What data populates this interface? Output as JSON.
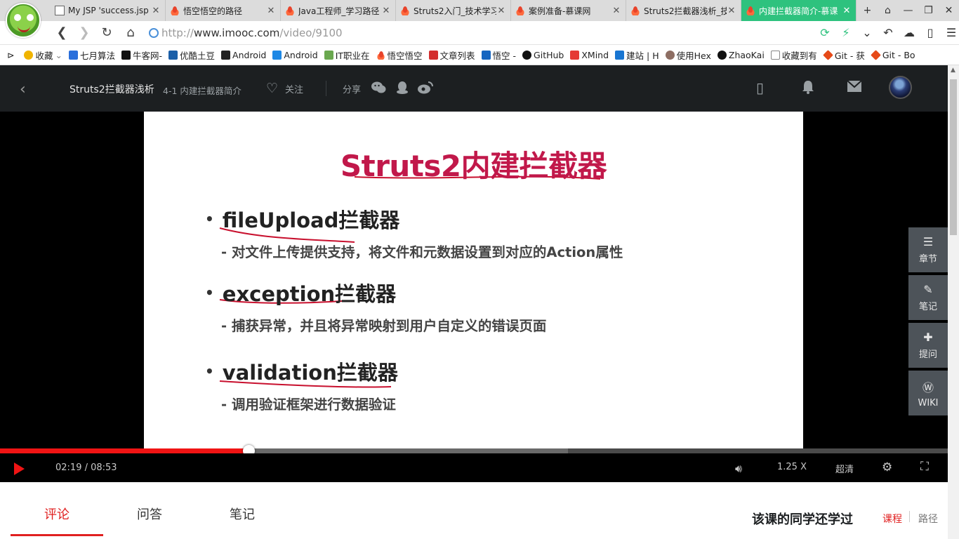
{
  "browser": {
    "tabs": [
      {
        "title": "My JSP 'success.jsp",
        "icon": "page-icon",
        "active": false
      },
      {
        "title": "悟空悟空的路径",
        "icon": "fire-icon",
        "active": false
      },
      {
        "title": "Java工程师_学习路径",
        "icon": "fire-icon",
        "active": false
      },
      {
        "title": "Struts2入门_技术学习",
        "icon": "fire-icon",
        "active": false
      },
      {
        "title": "案例准备-慕课网",
        "icon": "fire-icon",
        "active": false
      },
      {
        "title": "Struts2拦截器浅析_技",
        "icon": "fire-icon",
        "active": false
      },
      {
        "title": "内建拦截器简介-慕课",
        "icon": "fire-icon",
        "active": true
      }
    ],
    "url": {
      "scheme": "http://",
      "host": "www.imooc.com",
      "path": "/video/9100"
    },
    "bookmarks": [
      {
        "label": "收藏",
        "color": "#f0b400"
      },
      {
        "label": "七月算法",
        "color": "#2a6fdb"
      },
      {
        "label": "牛客网-",
        "color": "#111111"
      },
      {
        "label": "优酷土豆",
        "color": "#1b5fa8"
      },
      {
        "label": "Android",
        "color": "#222222"
      },
      {
        "label": "Android",
        "color": "#1e88e5"
      },
      {
        "label": "IT职业在",
        "color": "#6aa84f"
      },
      {
        "label": "悟空悟空",
        "color": "#e8432b"
      },
      {
        "label": "文章列表",
        "color": "#d32f2f"
      },
      {
        "label": "悟空 -",
        "color": "#1565c0"
      },
      {
        "label": "GitHub",
        "color": "#111111"
      },
      {
        "label": "XMind",
        "color": "#e53935"
      },
      {
        "label": "建站 | H",
        "color": "#1976d2"
      },
      {
        "label": "使用Hex",
        "color": "#8d6e63"
      },
      {
        "label": "ZhaoKai",
        "color": "#111111"
      },
      {
        "label": "收藏到有",
        "color": "#888888"
      },
      {
        "label": "Git - 获",
        "color": "#e64a19"
      },
      {
        "label": "Git - Bo",
        "color": "#e64a19"
      }
    ],
    "accent_color": "#2ec27e"
  },
  "header": {
    "course_title": "Struts2拦截器浅析",
    "lesson_title": "4-1 内建拦截器简介",
    "follow_label": "关注",
    "share_label": "分享"
  },
  "slide": {
    "title": "Struts2内建拦截器",
    "items": [
      {
        "heading": "fileUpload拦截器",
        "desc": "- 对文件上传提供支持，将文件和元数据设置到对应的Action属性"
      },
      {
        "heading": "exception拦截器",
        "desc": "- 捕获异常，并且将异常映射到用户自定义的错误页面"
      },
      {
        "heading": "validation拦截器",
        "desc": "- 调用验证框架进行数据验证"
      }
    ]
  },
  "side_panel": [
    {
      "label": "章节",
      "icon": "list-icon"
    },
    {
      "label": "笔记",
      "icon": "pencil-icon"
    },
    {
      "label": "提问",
      "icon": "question-icon"
    },
    {
      "label": "WIKI",
      "icon": "wiki-icon"
    }
  ],
  "player": {
    "current_time": "02:19",
    "duration": "08:53",
    "time_display": "02:19 / 08:53",
    "played_fraction": 0.262,
    "buffered_fraction": 0.599,
    "speed": "1.25 X",
    "quality": "超清",
    "accent_color": "#f01414"
  },
  "tabs": {
    "comment": "评论",
    "qa": "问答",
    "notes": "笔记"
  },
  "sidebar": {
    "heading": "该课的同学还学过",
    "link_course": "课程",
    "link_path": "路径"
  }
}
